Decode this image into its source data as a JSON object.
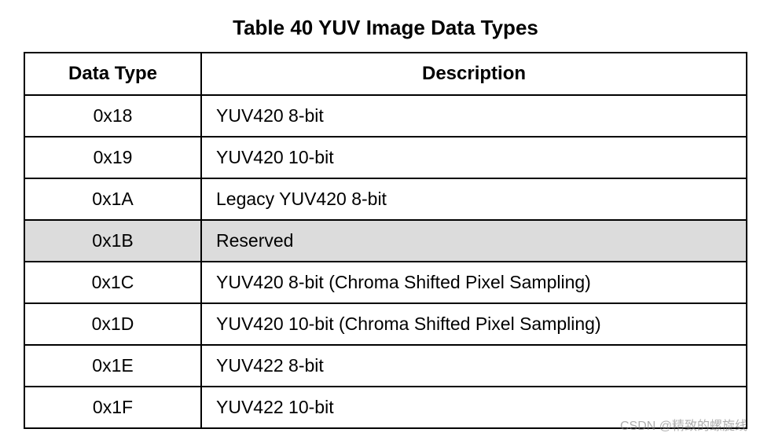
{
  "table": {
    "title": "Table 40 YUV Image Data Types",
    "headers": {
      "col0": "Data Type",
      "col1": "Description"
    },
    "rows": [
      {
        "type": "0x18",
        "desc": "YUV420 8-bit",
        "reserved": false
      },
      {
        "type": "0x19",
        "desc": "YUV420 10-bit",
        "reserved": false
      },
      {
        "type": "0x1A",
        "desc": "Legacy YUV420 8-bit",
        "reserved": false
      },
      {
        "type": "0x1B",
        "desc": "Reserved",
        "reserved": true
      },
      {
        "type": "0x1C",
        "desc": "YUV420 8-bit (Chroma Shifted Pixel Sampling)",
        "reserved": false
      },
      {
        "type": "0x1D",
        "desc": "YUV420 10-bit (Chroma Shifted Pixel Sampling)",
        "reserved": false
      },
      {
        "type": "0x1E",
        "desc": "YUV422 8-bit",
        "reserved": false
      },
      {
        "type": "0x1F",
        "desc": "YUV422 10-bit",
        "reserved": false
      }
    ]
  },
  "watermark": "CSDN @精致的螺旋线"
}
